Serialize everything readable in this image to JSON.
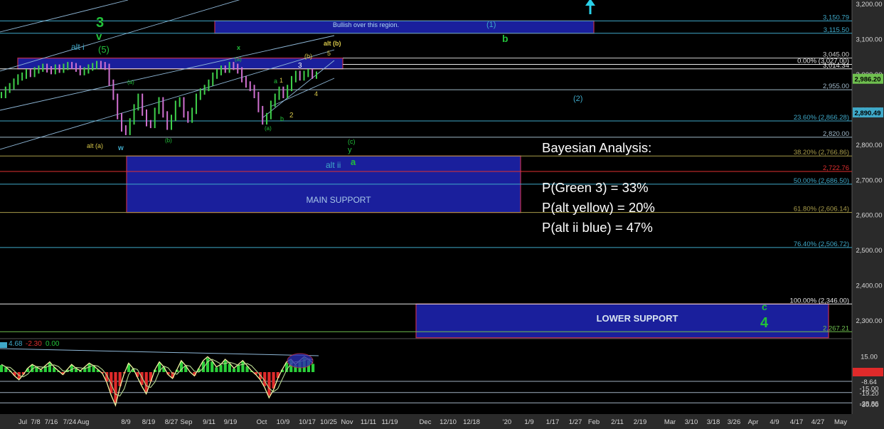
{
  "chart_data": {
    "type": "line",
    "title": "",
    "xlabel": "",
    "ylabel": "",
    "ylim": [
      2175,
      3200
    ],
    "y_ticks": [
      "3,200.00",
      "3,100.00",
      "3,000.00",
      "2,900.00",
      "2,800.00",
      "2,700.00",
      "2,600.00",
      "2,500.00",
      "2,400.00",
      "2,300.00"
    ],
    "x_ticks": [
      "Jul",
      "7/8",
      "7/16",
      "7/24",
      "Aug",
      "8/9",
      "8/19",
      "8/27",
      "Sep",
      "9/11",
      "9/19",
      "Oct",
      "10/9",
      "10/17",
      "10/25",
      "Nov",
      "11/11",
      "11/19",
      "Dec",
      "12/10",
      "12/18",
      "'20",
      "1/9",
      "1/17",
      "1/27",
      "Feb",
      "2/11",
      "2/19",
      "Mar",
      "3/10",
      "3/18",
      "3/26",
      "Apr",
      "4/9",
      "4/17",
      "4/27",
      "May"
    ],
    "price_series": [
      2940,
      2955,
      2965,
      2978,
      2990,
      2995,
      3005,
      3000,
      3010,
      3015,
      3020,
      3013,
      3008,
      3018,
      3012,
      3020,
      3025,
      3022,
      3015,
      3005,
      3010,
      3018,
      3022,
      3028,
      3025,
      3020,
      2975,
      2935,
      2880,
      2845,
      2835,
      2865,
      2905,
      2935,
      2890,
      2860,
      2855,
      2895,
      2925,
      2885,
      2850,
      2875,
      2915,
      2925,
      2885,
      2870,
      2895,
      2935,
      2950,
      2960,
      2975,
      2995,
      3005,
      3015,
      3012,
      3025,
      3020,
      3010,
      2985,
      2970,
      2960,
      2940,
      2900,
      2865,
      2880,
      2915,
      2935,
      2955,
      2940,
      2960,
      2985,
      3000,
      2990,
      3000,
      3005,
      2995,
      2998
    ],
    "levels": [
      {
        "label": "3,150.79",
        "value": 3150.79,
        "color": "#3fa9c9"
      },
      {
        "label": "3,115.50",
        "value": 3115.5,
        "color": "#3fa9c9"
      },
      {
        "label": "3,045.00",
        "value": 3045.0,
        "color": "#cfcfcf"
      },
      {
        "label": "0.00% (3,027.00)",
        "value": 3027.0,
        "color": "#e8e8e8"
      },
      {
        "label": "3,014.34",
        "value": 3014.34,
        "color": "#e8e8e8"
      },
      {
        "label": "2,955.00",
        "value": 2955.0,
        "color": "#a0b8c8"
      },
      {
        "label": "23.60% (2,866.28)",
        "value": 2866.28,
        "color": "#3fa9c9"
      },
      {
        "label": "2,820.00",
        "value": 2820.0,
        "color": "#a0b8c8"
      },
      {
        "label": "38.20% (2,766.86)",
        "value": 2766.86,
        "color": "#a89c4a"
      },
      {
        "label": "2,722.76",
        "value": 2722.76,
        "color": "#e03030"
      },
      {
        "label": "50.00% (2,686.50)",
        "value": 2686.5,
        "color": "#3fa9c9"
      },
      {
        "label": "61.80% (2,606.14)",
        "value": 2606.14,
        "color": "#a89c4a"
      },
      {
        "label": "76.40% (2,506.72)",
        "value": 2506.72,
        "color": "#3fa9c9"
      },
      {
        "label": "100.00% (2,346.00)",
        "value": 2346.0,
        "color": "#e8e8e8"
      },
      {
        "label": "2,267.21",
        "value": 2267.21,
        "color": "#6fbf4f"
      }
    ],
    "price_tags": [
      {
        "label": "2,986.20",
        "value": 2986.2,
        "color": "#6fbf4f"
      },
      {
        "label": "2,890.49",
        "value": 2890.49,
        "color": "#3fa9c9"
      }
    ],
    "zones": [
      {
        "label": "Bullish over this region.",
        "top": 3150.79,
        "bottom": 3115.5,
        "x0": 302,
        "x1": 835
      },
      {
        "label": "MAIN SUPPORT",
        "top": 2766.86,
        "bottom": 2606.14,
        "x0": 178,
        "x1": 732
      },
      {
        "label": "LOWER SUPPORT",
        "top": 2346.0,
        "bottom": 2250.0,
        "x0": 585,
        "x1": 1165
      },
      {
        "label": "",
        "top": 3045.0,
        "bottom": 3014.34,
        "x0": 25,
        "x1": 482
      }
    ],
    "annotations": [
      {
        "text": "3",
        "color": "#22c03a"
      },
      {
        "text": "v",
        "color": "#22c03a"
      },
      {
        "text": "(5)",
        "color": "#22c03a"
      },
      {
        "text": "alt i",
        "color": "#3fa9c9"
      },
      {
        "text": "alt (a)",
        "color": "#d8c84a"
      },
      {
        "text": "w",
        "color": "#3fa9c9"
      },
      {
        "text": "(a)",
        "color": "#22c03a"
      },
      {
        "text": "(b)",
        "color": "#22c03a"
      },
      {
        "text": "x",
        "color": "#22c03a"
      },
      {
        "text": "(a)",
        "color": "#22c03a"
      },
      {
        "text": "(b)",
        "color": "#d8c84a"
      },
      {
        "text": "alt (b)",
        "color": "#d8c84a"
      },
      {
        "text": "5",
        "color": "#d8c84a"
      },
      {
        "text": "3",
        "color": "#ffffff"
      },
      {
        "text": "4",
        "color": "#d8c84a"
      },
      {
        "text": "2",
        "color": "#d8c84a"
      },
      {
        "text": "1",
        "color": "#d8c84a"
      },
      {
        "text": "a",
        "color": "#22c03a"
      },
      {
        "text": "b",
        "color": "#22c03a"
      },
      {
        "text": "(a)",
        "color": "#22c03a"
      },
      {
        "text": "(c)",
        "color": "#22c03a"
      },
      {
        "text": "y",
        "color": "#22c03a"
      },
      {
        "text": "alt ii",
        "color": "#3fa9c9"
      },
      {
        "text": "a",
        "color": "#22c03a"
      },
      {
        "text": "(1)",
        "color": "#3fa9c9"
      },
      {
        "text": "b",
        "color": "#22c03a"
      },
      {
        "text": "(2)",
        "color": "#3fa9c9"
      },
      {
        "text": "c",
        "color": "#22c03a"
      },
      {
        "text": "4",
        "color": "#22c03a"
      }
    ],
    "indicator": {
      "readouts": [
        {
          "text": "4.68",
          "color": "#3fa9c9"
        },
        {
          "text": "-2.30",
          "color": "#e03030"
        },
        {
          "text": "0.00",
          "color": "#22c03a"
        }
      ],
      "y_ticks": [
        "15.00",
        "-8.64",
        "-15.00",
        "-19.20",
        "-28.86",
        "-30.00"
      ],
      "values": [
        6,
        4,
        1,
        -3,
        -6,
        -2,
        3,
        6,
        4,
        2,
        5,
        8,
        4,
        1,
        -2,
        2,
        6,
        3,
        1,
        4,
        7,
        5,
        2,
        -1,
        -8,
        -18,
        -26,
        -12,
        -1,
        7,
        3,
        -4,
        -11,
        -17,
        -8,
        2,
        8,
        4,
        -2,
        -5,
        2,
        9,
        5,
        0,
        -3,
        3,
        9,
        12,
        9,
        4,
        6,
        10,
        7,
        3,
        6,
        9,
        5,
        1,
        -2,
        -6,
        -12,
        -20,
        -14,
        -5,
        2,
        8,
        10,
        6,
        9,
        12,
        10,
        7
      ]
    },
    "colors": {
      "background": "#000000",
      "price_up": "#3fd04a",
      "price_down": "#d070d0",
      "zone_fill": "#1a1f9c",
      "zone_border": "#c03050",
      "channel": "#8fb8d8"
    }
  },
  "bayes": {
    "title": "Bayesian Analysis:",
    "lines": [
      "P(Green 3) = 33%",
      "P(alt yellow) = 20%",
      "P(alt ii blue) = 47%"
    ]
  }
}
